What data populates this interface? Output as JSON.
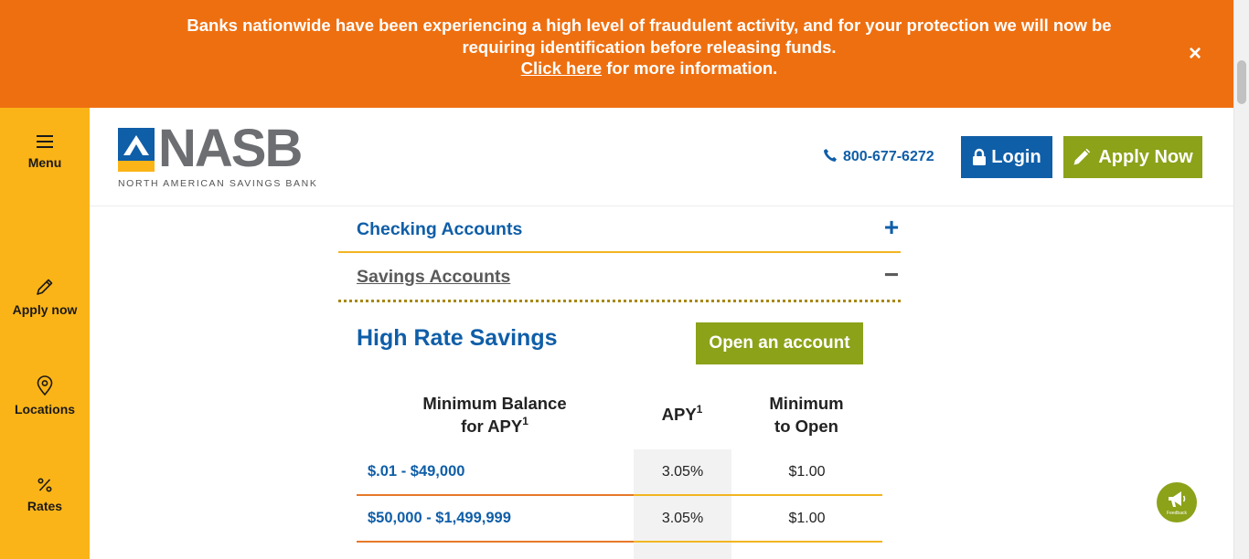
{
  "alert": {
    "line1": "Banks nationwide have been experiencing a high level of fraudulent activity, and for your protection we will now be requiring identification before releasing funds.",
    "link": "Click here",
    "line2_rest": " for more information.",
    "close": "×"
  },
  "rail": {
    "items": [
      {
        "label": "Menu",
        "icon": "hamburger-icon"
      },
      {
        "label": "Apply now",
        "icon": "pencil-icon"
      },
      {
        "label": "Locations",
        "icon": "map-pin-icon"
      },
      {
        "label": "Rates",
        "icon": "percent-icon"
      }
    ]
  },
  "header": {
    "logo_text": "NASB",
    "logo_tagline": "NORTH AMERICAN SAVINGS BANK",
    "phone": "800-677-6272",
    "login": "Login",
    "apply": "Apply Now"
  },
  "accordion": {
    "checking": {
      "title": "Checking Accounts",
      "sign": "+"
    },
    "savings": {
      "title": "Savings Accounts",
      "sign": "−"
    }
  },
  "product": {
    "title": "High Rate Savings",
    "open_button": "Open an account"
  },
  "table": {
    "headers": {
      "balance_line1": "Minimum Balance",
      "balance_line2": "for APY",
      "balance_sup": "1",
      "apy": "APY",
      "apy_sup": "1",
      "min_line1": "Minimum",
      "min_line2": "to Open"
    },
    "rows": [
      {
        "range": "$.01 - $49,000",
        "apy": "3.05%",
        "min": "$1.00"
      },
      {
        "range": "$50,000 - $1,499,999",
        "apy": "3.05%",
        "min": "$1.00"
      }
    ]
  },
  "feedback": {
    "label": "Feedback"
  },
  "colors": {
    "banner": "#ee6f10",
    "rail": "#fbb417",
    "brand_blue": "#0f5ea8",
    "brand_green": "#8ba219",
    "divider_gold": "#f2b521",
    "divider_orange": "#e7792a"
  }
}
